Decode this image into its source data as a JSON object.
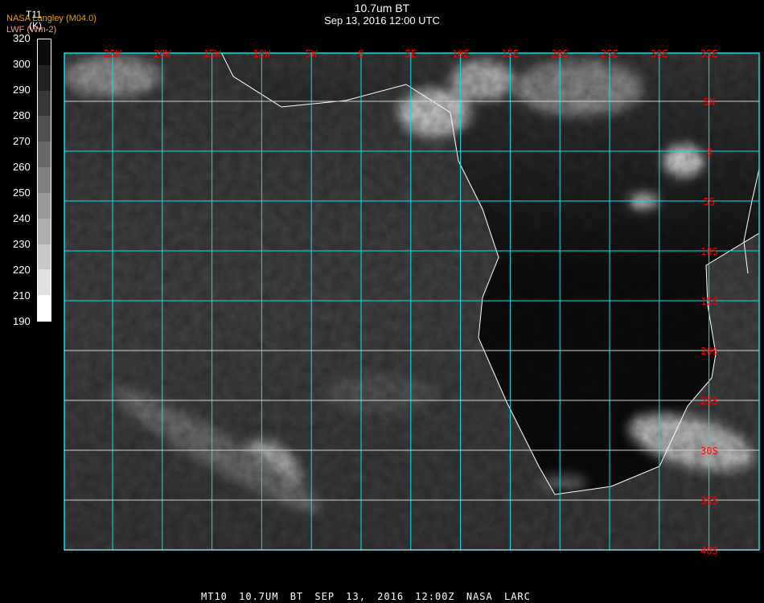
{
  "header": {
    "title": "10.7um BT",
    "subtitle": "Sep 13, 2016 12:00 UTC",
    "organization": "NASA Langley (M04.0)",
    "secondary_label": "LWF (Wm-2)"
  },
  "colorbar": {
    "variable": "T11",
    "units": "(K)",
    "ticks": [
      "320",
      "300",
      "290",
      "280",
      "270",
      "260",
      "250",
      "240",
      "230",
      "220",
      "210",
      "190"
    ],
    "colors": [
      "#0c0c0c",
      "#222222",
      "#383838",
      "#505050",
      "#686868",
      "#808080",
      "#989898",
      "#b0b0b0",
      "#c8c8c8",
      "#e2e2e2",
      "#ffffff"
    ]
  },
  "map": {
    "lon_labels": [
      "25W",
      "20W",
      "15W",
      "10W",
      "5W",
      "0",
      "5E",
      "10E",
      "15E",
      "20E",
      "25E",
      "30E",
      "35E"
    ],
    "lat_labels": [
      "5N",
      "0",
      "5S",
      "10S",
      "15S",
      "20S",
      "25S",
      "30S",
      "35S",
      "40S"
    ],
    "grid_color": "#00e5ee",
    "label_color": "#ff0000",
    "coast_color": "#ffffff"
  },
  "footer": "MT10  10.7UM BT   SEP 13, 2016 12:00Z   NASA LARC"
}
